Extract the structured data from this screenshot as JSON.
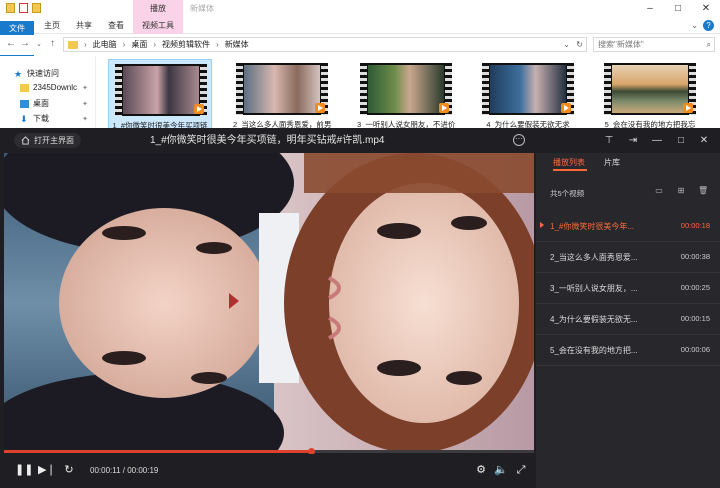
{
  "explorer": {
    "contextual_tab": "播放",
    "window_title": "新媒体",
    "ribbon_tabs": [
      "文件",
      "主页",
      "共享",
      "查看",
      "视频工具"
    ],
    "breadcrumb": [
      "此电脑",
      "桌面",
      "视频剪辑软件",
      "新媒体"
    ],
    "search_placeholder": "搜索\"新媒体\"",
    "nav": [
      {
        "label": "快速访问",
        "icon": "star-icon"
      },
      {
        "label": "2345Downlc",
        "icon": "folder-icon"
      },
      {
        "label": "桌面",
        "icon": "desktop-icon"
      },
      {
        "label": "下载",
        "icon": "download-icon"
      }
    ],
    "files": [
      {
        "name": "1_#你微笑时很美今年买项链"
      },
      {
        "name": "2_当这么多人面秀恩爱，前男"
      },
      {
        "name": "3_一听别人说女朋友，不进价"
      },
      {
        "name": "4_为什么要假装无欲无求"
      },
      {
        "name": "5_会在没有我的地方把我忘"
      }
    ]
  },
  "player": {
    "home_label": "打开主界面",
    "title": "1_#你微笑时很美今年买项链，明年买钻戒#许凯.mp4",
    "current_time": "00:00:11",
    "total_time": "00:00:19",
    "progress": 0.58,
    "tabs": [
      "播放列表",
      "片库"
    ],
    "count_label": "共5个视频",
    "playlist": [
      {
        "name": "1_#你微笑时很美今年...",
        "duration": "00:00:18",
        "active": true
      },
      {
        "name": "2_当这么多人面秀恩爱...",
        "duration": "00:00:38",
        "active": false
      },
      {
        "name": "3_一听别人说女朋友，...",
        "duration": "00:00:25",
        "active": false
      },
      {
        "name": "4_为什么要假装无欲无...",
        "duration": "00:00:15",
        "active": false
      },
      {
        "name": "5_会在没有我的地方把...",
        "duration": "00:00:06",
        "active": false
      }
    ],
    "accent": "#ff6a3d",
    "seek_color": "#e0412f"
  }
}
